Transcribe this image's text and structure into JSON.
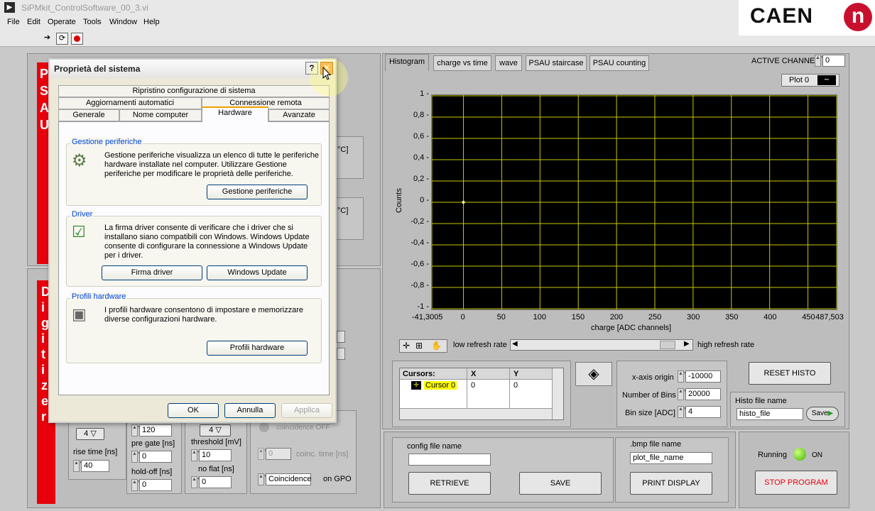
{
  "window": {
    "title": "SiPMkit_ControlSoftware_00_3.vi"
  },
  "menu": [
    "File",
    "Edit",
    "Operate",
    "Tools",
    "Window",
    "Help"
  ],
  "brand": {
    "name": "CAEN",
    "logo_letter": "n",
    "color": "#c8102e"
  },
  "left_panel": {
    "top_letters": [
      "P",
      "S",
      "A",
      "U"
    ],
    "bottom_letters": [
      "D",
      "i",
      "g",
      "i",
      "t",
      "i",
      "z",
      "e",
      "r"
    ],
    "unit_label_1": "°C]",
    "unit_label_2": "°C]"
  },
  "digitizer": {
    "col1": {
      "select_value": "4",
      "rise_time_label": "rise time [ns]",
      "rise_time_value": "40"
    },
    "col2": {
      "top_value": "120",
      "pre_gate_label": "pre gate [ns]",
      "pre_gate_value": "0",
      "hold_off_label": "hold-off [ns]",
      "hold_off_value": "0"
    },
    "col3": {
      "select_value": "4",
      "threshold_label": "threshold [mV]",
      "threshold_value": "10",
      "no_flat_label": "no flat [ns]",
      "no_flat_value": "0"
    },
    "col4": {
      "coincidence_off": "coincidence OFF",
      "coinc_time_value": "0",
      "coinc_time_label": "coinc. time [ns]",
      "coincidence_select": "Coincidence",
      "on_gpo_label": "on GPO"
    }
  },
  "dialog": {
    "title": "Proprietà del sistema",
    "tabs_row1": [
      "Ripristino configurazione di sistema"
    ],
    "tabs_row2": [
      "Aggiornamenti automatici",
      "Connessione remota"
    ],
    "tabs_row3": [
      "Generale",
      "Nome computer",
      "Hardware",
      "Avanzate"
    ],
    "active_tab": "Hardware",
    "groups": [
      {
        "label": "Gestione periferiche",
        "text": [
          "Gestione periferiche visualizza un elenco di tutte le periferiche",
          "hardware installate nel computer. Utilizzare Gestione",
          "periferiche per modificare le proprietà delle periferiche."
        ],
        "buttons": [
          "Gestione periferiche"
        ]
      },
      {
        "label": "Driver",
        "text": [
          "La firma driver consente di verificare che i driver che si",
          "installano siano compatibili con Windows. Windows Update",
          "consente di configurare la connessione a Windows Update",
          "per i driver."
        ],
        "buttons": [
          "Firma driver",
          "Windows Update"
        ]
      },
      {
        "label": "Profili hardware",
        "text": [
          "I profili hardware consentono di impostare e memorizzare",
          "diverse configurazioni hardware."
        ],
        "buttons": [
          "Profili hardware"
        ]
      }
    ],
    "ok": "OK",
    "cancel": "Annulla",
    "apply": "Applica"
  },
  "right": {
    "tabs": [
      "Histogram",
      "charge vs time",
      "wave",
      "PSAU staircase",
      "PSAU counting"
    ],
    "active_channel_label": "ACTIVE CHANNEL",
    "active_channel_value": "0",
    "plot_legend": "Plot 0",
    "y_label": "Counts",
    "x_label": "charge [ADC channels]",
    "y_ticks": [
      "1",
      "0,8",
      "0,6",
      "0,4",
      "0,2",
      "0",
      "-0,2",
      "-0,4",
      "-0,6",
      "-0,8",
      "-1"
    ],
    "x_ticks": [
      "-41,3005",
      "0",
      "50",
      "100",
      "150",
      "200",
      "250",
      "300",
      "350",
      "400",
      "450",
      "487,503"
    ],
    "low_refresh": "low refresh rate",
    "high_refresh": "high refresh rate",
    "cursors": {
      "h_name": "Cursors:",
      "h_x": "X",
      "h_y": "Y",
      "name": "Cursor 0",
      "x": "0",
      "y": "0"
    },
    "x_origin_label": "x-axis origin",
    "x_origin_value": "-10000",
    "nbins_label": "Number of Bins",
    "nbins_value": "20000",
    "binsize_label": "Bin size [ADC]",
    "binsize_value": "4",
    "reset_histo": "RESET HISTO",
    "histo_file_label": "Histo file name",
    "histo_file_value": "histo_file",
    "save_small": "Save",
    "config_label": "config file name",
    "config_value": "",
    "retrieve": "RETRIEVE",
    "save": "SAVE",
    "bmp_label": ".bmp file name",
    "bmp_value": "plot_file_name",
    "print_display": "PRINT DISPLAY",
    "running_label": "Running",
    "running_state": "ON",
    "stop_program": "STOP PROGRAM",
    "plot_bg": "#000000",
    "grid_color": "#c8c800",
    "stop_color": "#e8000b"
  }
}
